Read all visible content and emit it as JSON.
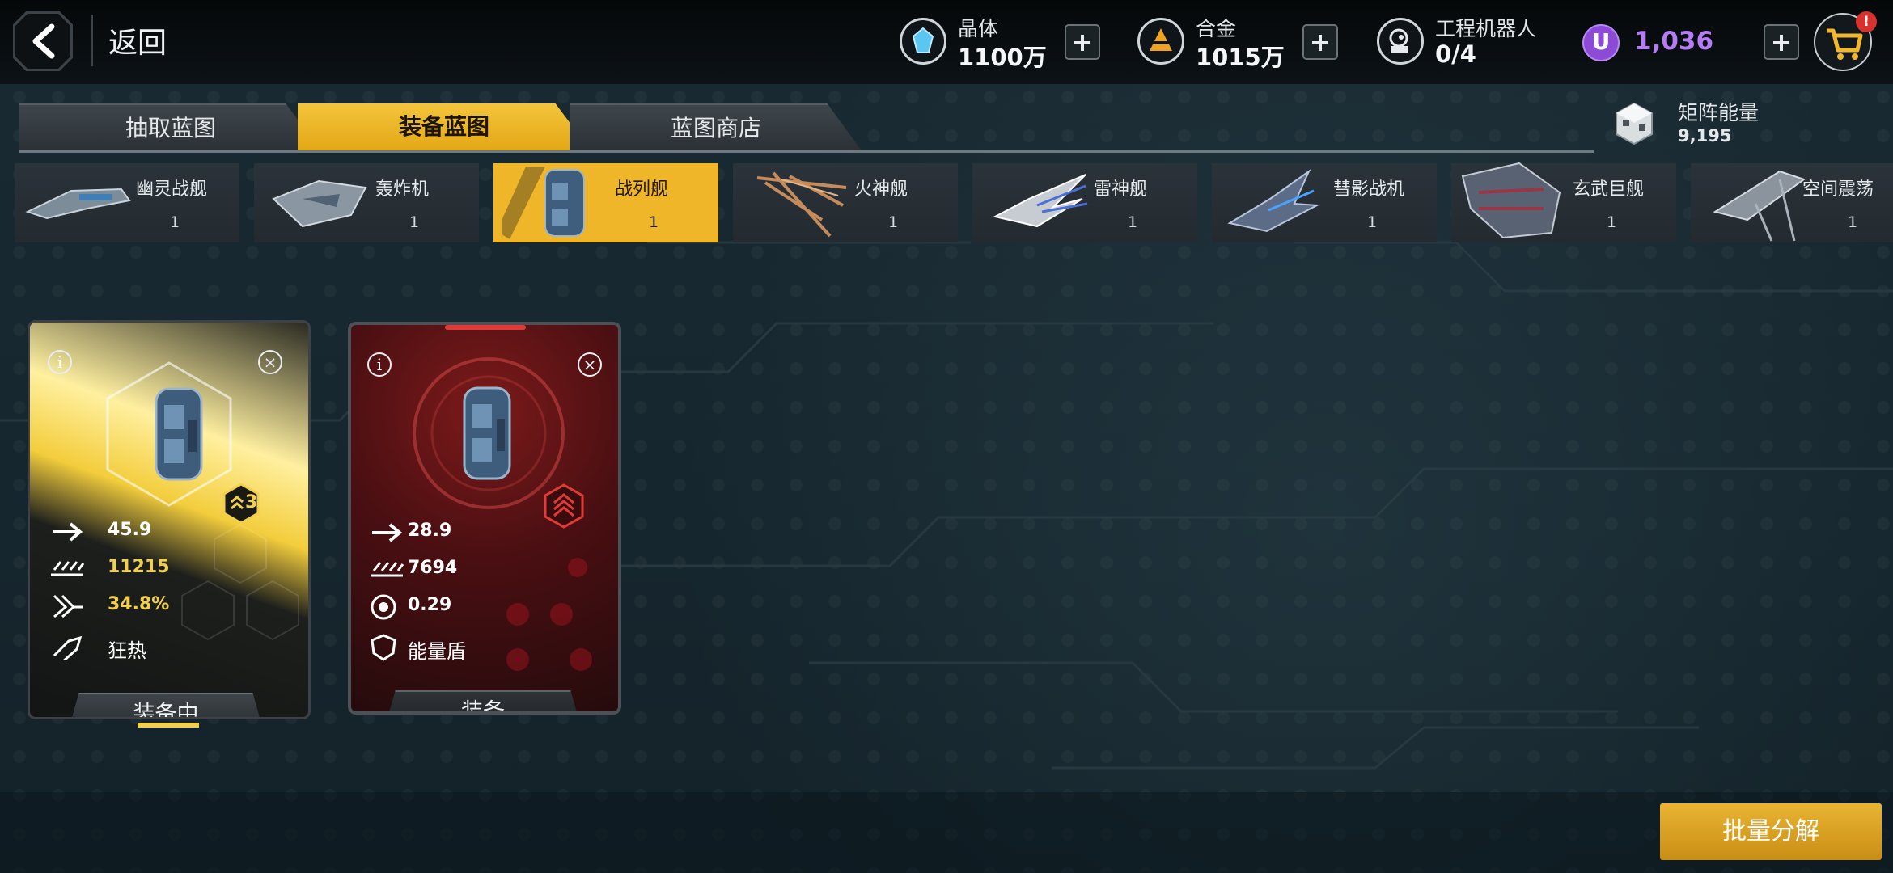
{
  "header": {
    "back_label": "返回",
    "resources": [
      {
        "name": "晶体",
        "value": "1100万",
        "icon": "crystal-icon"
      },
      {
        "name": "合金",
        "value": "1015万",
        "icon": "alloy-icon"
      },
      {
        "name": "工程机器人",
        "value": "0/4",
        "icon": "robot-icon"
      }
    ],
    "premium_currency": {
      "symbol": "U",
      "value": "1,036"
    },
    "cart_badge": "!"
  },
  "tabs": [
    {
      "label": "抽取蓝图",
      "active": false
    },
    {
      "label": "装备蓝图",
      "active": true
    },
    {
      "label": "蓝图商店",
      "active": false
    }
  ],
  "matrix_energy": {
    "label": "矩阵能量",
    "value": "9,195"
  },
  "ship_categories": [
    {
      "name": "幽灵战舰",
      "count": "1",
      "selected": false
    },
    {
      "name": "轰炸机",
      "count": "1",
      "selected": false
    },
    {
      "name": "战列舰",
      "count": "1",
      "selected": true
    },
    {
      "name": "火神舰",
      "count": "1",
      "selected": false
    },
    {
      "name": "雷神舰",
      "count": "1",
      "selected": false
    },
    {
      "name": "彗影战机",
      "count": "1",
      "selected": false
    },
    {
      "name": "玄武巨舰",
      "count": "1",
      "selected": false
    },
    {
      "name": "空间震荡",
      "count": "1",
      "selected": false
    }
  ],
  "blueprints": [
    {
      "rank": "3",
      "stats": [
        {
          "icon": "speed-arrow-icon",
          "value": "45.9"
        },
        {
          "icon": "armor-icon",
          "value": "11215"
        },
        {
          "icon": "critical-icon",
          "value": "34.8%"
        },
        {
          "icon": "skill-icon",
          "value": "狂热"
        }
      ],
      "button": "装备中",
      "accent": "#f2cf4c"
    },
    {
      "rank": "",
      "stats": [
        {
          "icon": "speed-arrow-icon",
          "value": "28.9"
        },
        {
          "icon": "armor-icon",
          "value": "7694"
        },
        {
          "icon": "rate-icon",
          "value": "0.29"
        },
        {
          "icon": "shield-icon",
          "value": "能量盾"
        }
      ],
      "button": "装备",
      "accent": "#d8322e"
    }
  ],
  "batch_button": "批量分解",
  "colors": {
    "accent_gold": "#efb62a",
    "premium_purple": "#8c4ad7",
    "alert_red": "#d8322e"
  }
}
